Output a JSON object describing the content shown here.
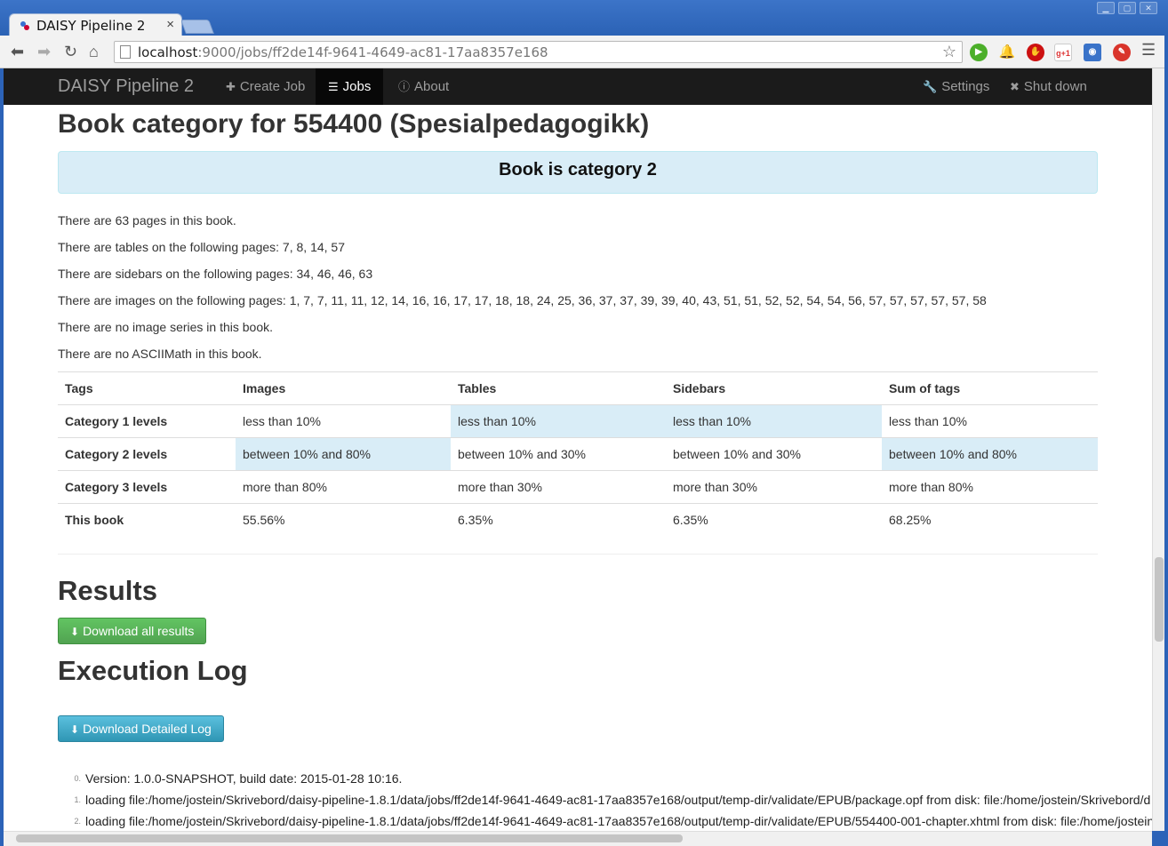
{
  "browser": {
    "tab_title": "DAISY Pipeline 2",
    "tab_close": "×",
    "url_host": "localhost",
    "url_rest": ":9000/jobs/ff2de14f-9641-4649-ac81-17aa8357e168",
    "extensions": [
      {
        "icon": "play-extension-icon",
        "color": "#4caf2a",
        "label": "▶"
      },
      {
        "icon": "bell-icon",
        "color": "#bbbbbb",
        "label": "🔔"
      },
      {
        "icon": "stop-extension-icon",
        "color": "#cc1111",
        "label": "✋"
      },
      {
        "icon": "google-plus-icon",
        "color": "#dddddd",
        "label": "g+1"
      },
      {
        "icon": "camera-extension-icon",
        "color": "#3a73c9",
        "label": "◉"
      },
      {
        "icon": "notification-extension-icon",
        "color": "#d9342b",
        "label": "✎"
      }
    ]
  },
  "navbar": {
    "brand": "DAISY Pipeline 2",
    "create_job": "Create Job",
    "jobs": "Jobs",
    "about": "About",
    "settings": "Settings",
    "shut_down": "Shut down"
  },
  "category": {
    "heading": "Book category for 554400 (Spesialpedagogikk)",
    "alert": "Book is category 2",
    "paragraphs": [
      "There are 63 pages in this book.",
      "There are tables on the following pages: 7, 8, 14, 57",
      "There are sidebars on the following pages: 34, 46, 46, 63",
      "There are images on the following pages: 1, 7, 7, 11, 11, 12, 14, 16, 16, 17, 17, 18, 18, 24, 25, 36, 37, 37, 39, 39, 40, 43, 51, 51, 52, 52, 54, 54, 56, 57, 57, 57, 57, 57, 58",
      "There are no image series in this book.",
      "There are no ASCIIMath in this book."
    ]
  },
  "levels_table": {
    "headers": [
      "Tags",
      "Images",
      "Tables",
      "Sidebars",
      "Sum of tags"
    ],
    "rows": [
      [
        "Category 1 levels",
        "less than 10%",
        "less than 10%",
        "less than 10%",
        "less than 10%"
      ],
      [
        "Category 2 levels",
        "between 10% and 80%",
        "between 10% and 30%",
        "between 10% and 30%",
        "between 10% and 80%"
      ],
      [
        "Category 3 levels",
        "more than 80%",
        "more than 30%",
        "more than 30%",
        "more than 80%"
      ],
      [
        "This book",
        "55.56%",
        "6.35%",
        "6.35%",
        "68.25%"
      ]
    ]
  },
  "results": {
    "heading": "Results",
    "download_all": "Download all results"
  },
  "log": {
    "heading": "Execution Log",
    "download_log": "Download Detailed Log",
    "lines": [
      {
        "num": "0.",
        "text": "Version: 1.0.0-SNAPSHOT, build date: 2015-01-28 10:16."
      },
      {
        "num": "1.",
        "text": "loading file:/home/jostein/Skrivebord/daisy-pipeline-1.8.1/data/jobs/ff2de14f-9641-4649-ac81-17aa8357e168/output/temp-dir/validate/EPUB/package.opf from disk: file:/home/jostein/Skrivebord/d"
      },
      {
        "num": "2.",
        "text": "loading file:/home/jostein/Skrivebord/daisy-pipeline-1.8.1/data/jobs/ff2de14f-9641-4649-ac81-17aa8357e168/output/temp-dir/validate/EPUB/554400-001-chapter.xhtml from disk: file:/home/jostein"
      }
    ]
  }
}
